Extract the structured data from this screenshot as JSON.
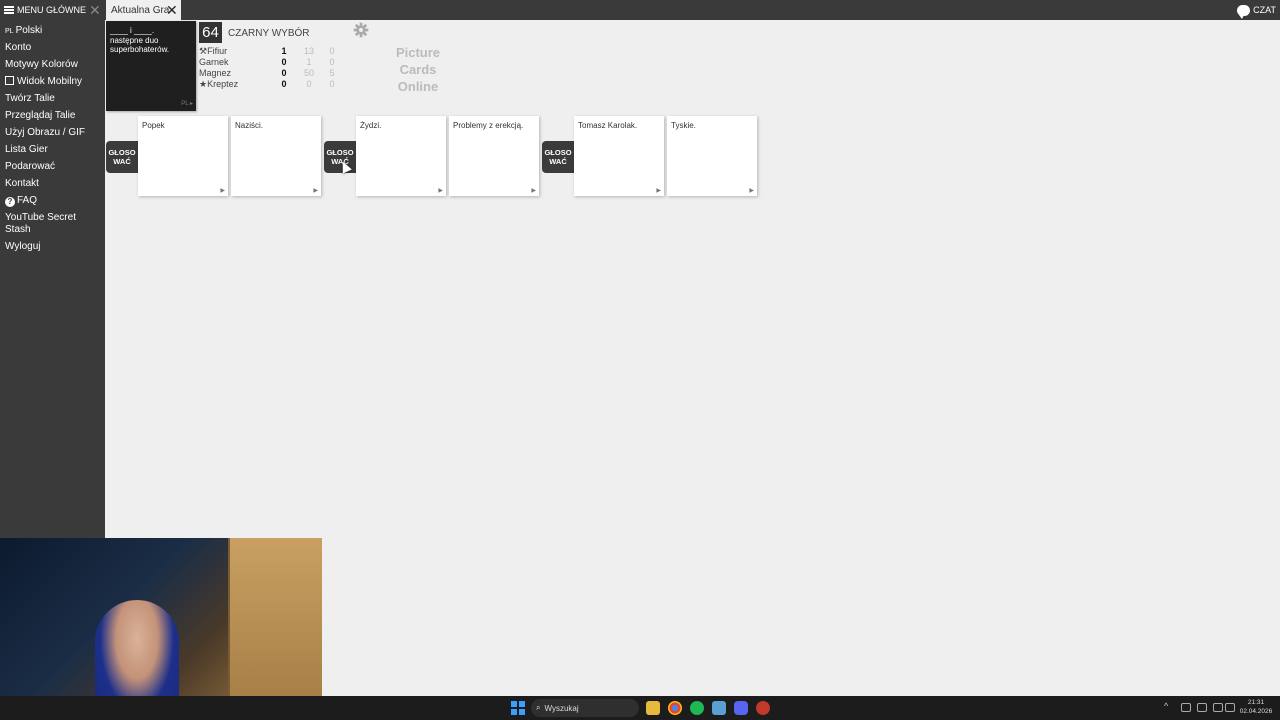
{
  "topbar": {
    "menu_label": "MENU GŁÓWNE",
    "menu_close": "✕",
    "tab_label": "Aktualna Gra",
    "tab_close": "✕",
    "chat_label": "CZAT"
  },
  "sidebar": {
    "items": [
      {
        "prefix": "PL",
        "label": "Polski"
      },
      {
        "label": "Konto"
      },
      {
        "label": "Motywy Kolorów"
      },
      {
        "label": "Widok Mobilny",
        "checkbox": true
      },
      {
        "label": "Twórz Talie"
      },
      {
        "label": "Przeglądaj Talie"
      },
      {
        "label": "Użyj Obrazu / GIF"
      },
      {
        "label": "Lista Gier"
      },
      {
        "label": "Podarować"
      },
      {
        "label": "Kontakt"
      },
      {
        "label": "FAQ",
        "icon": "question-icon"
      },
      {
        "label": "YouTube Secret",
        "label2": "Stash"
      },
      {
        "label": "Wyloguj"
      }
    ]
  },
  "black_card": {
    "blanks": "____ i ____.",
    "text": "następne duo superbohaterów.",
    "footer": "PL ▸"
  },
  "game": {
    "round": "64",
    "mode": "CZARNY WYBÓR",
    "players": [
      {
        "name": "Fifiur",
        "role_icon": "gavel-icon",
        "score": "1",
        "c2": "13",
        "c3": "0"
      },
      {
        "name": "Garnek",
        "role_icon": "",
        "score": "0",
        "c2": "1",
        "c3": "0"
      },
      {
        "name": "Magnez",
        "role_icon": "",
        "score": "0",
        "c2": "50",
        "c3": "5"
      },
      {
        "name": "Kreptez",
        "role_icon": "star-icon",
        "score": "0",
        "c2": "0",
        "c3": "0"
      }
    ],
    "logo_lines": [
      "Picture",
      "Cards",
      "Online"
    ]
  },
  "vote_label_1": "GŁOSO",
  "vote_label_2": "WAĆ",
  "card_groups": [
    {
      "cards": [
        "Popek",
        "Naziści."
      ]
    },
    {
      "cards": [
        "Żydzi.",
        "Problemy z erekcją."
      ]
    },
    {
      "cards": [
        "Tomasz Karolak.",
        "Tyskie."
      ]
    }
  ],
  "taskbar": {
    "search_label": "Wyszukaj",
    "time": "21:31",
    "date": "02.04.2026"
  },
  "colors": {
    "chrome": "#3a3a3a",
    "background": "#efefef",
    "black_card": "#1f1f1f",
    "vote_button": "#3b3b3b"
  }
}
